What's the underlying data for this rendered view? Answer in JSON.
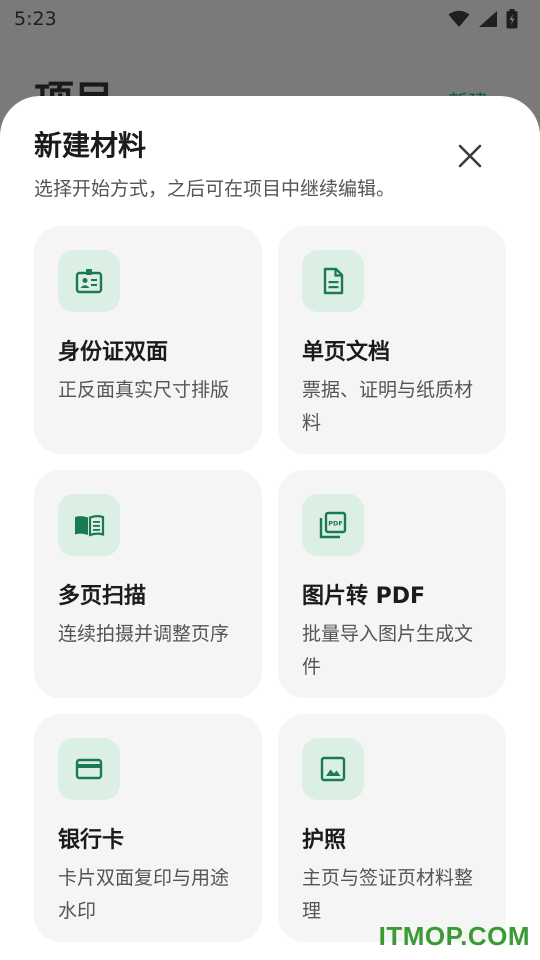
{
  "status_bar": {
    "time": "5:23"
  },
  "background": {
    "title": "项目",
    "action": "新建"
  },
  "sheet": {
    "title": "新建材料",
    "subtitle": "选择开始方式，之后可在项目中继续编辑。",
    "close_icon": "close-icon",
    "options": [
      {
        "title": "身份证双面",
        "desc": "正反面真实尺寸排版",
        "icon": "id-card-icon"
      },
      {
        "title": "单页文档",
        "desc": "票据、证明与纸质材料",
        "icon": "document-icon"
      },
      {
        "title": "多页扫描",
        "desc": "连续拍摄并调整页序",
        "icon": "book-icon"
      },
      {
        "title": "图片转 PDF",
        "desc": "批量导入图片生成文件",
        "icon": "pdf-icon"
      },
      {
        "title": "银行卡",
        "desc": "卡片双面复印与用途水印",
        "icon": "credit-card-icon"
      },
      {
        "title": "护照",
        "desc": "主页与签证页材料整理",
        "icon": "image-icon"
      }
    ]
  },
  "watermark": "ITMOP.COM",
  "colors": {
    "accent": "#1b7a52",
    "icon_bg": "#dcefe4",
    "card_bg": "#f4f5f4",
    "scrim": "#7a7a7a"
  }
}
